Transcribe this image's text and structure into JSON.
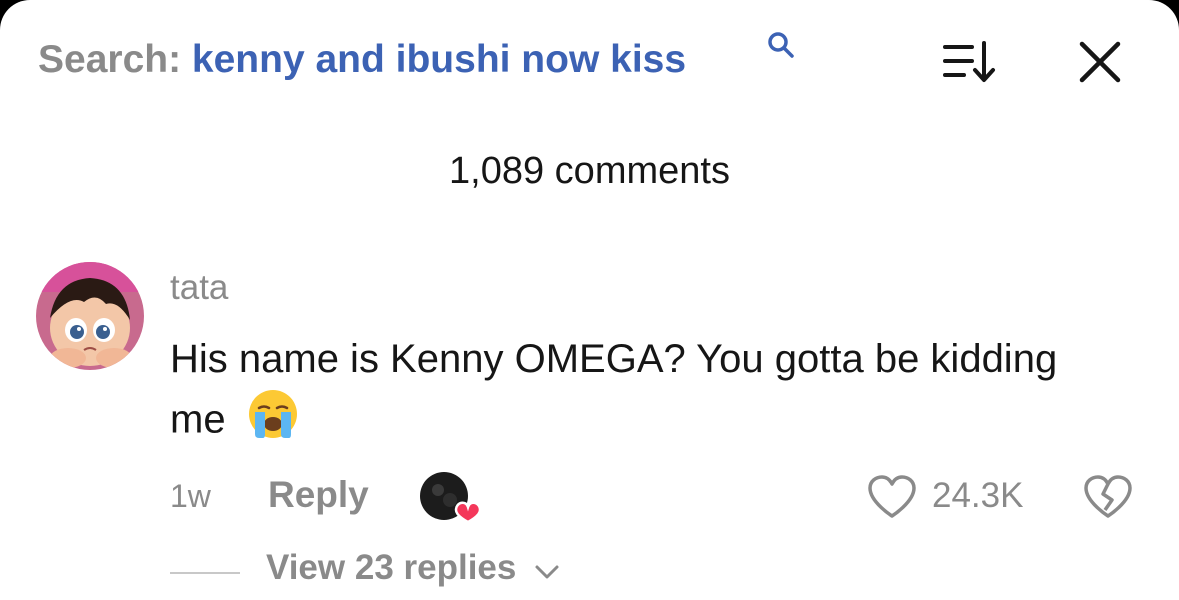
{
  "header": {
    "search_prefix": "Search:",
    "search_query": "kenny and ibushi now kiss",
    "icons": {
      "search": "search-icon",
      "sort": "sort-icon",
      "close": "close-icon"
    }
  },
  "comments_header": {
    "count_text": "1,089 comments"
  },
  "comment": {
    "username": "tata",
    "text": "His name is Kenny OMEGA? You gotta be kidding me",
    "emoji": "loudly-crying-face",
    "time": "1w",
    "reply_label": "Reply",
    "like_count": "24.3K",
    "view_replies_label": "View 23 replies"
  },
  "colors": {
    "accent_blue": "#3c62b4",
    "secondary_text": "#8a8a8a",
    "primary_text": "#161616",
    "heart_red": "#f4375a"
  }
}
